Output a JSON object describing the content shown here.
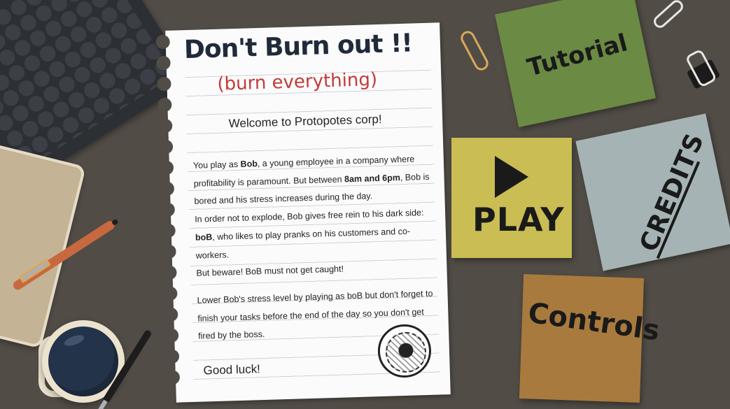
{
  "game": {
    "title": "Don't Burn out !!",
    "subtitle": "(burn everything)",
    "welcome": "Welcome to Protopotes corp!",
    "intro": {
      "line1_a": "You play as ",
      "bob": "Bob",
      "line1_b": ", a young employee in a company where profitability is paramount. But between ",
      "hours": "8am and 6pm",
      "line1_c": ", Bob is bored and his stress increases during the day.",
      "line2_a": "In order not to explode, Bob gives free rein to his dark side: ",
      "bob_dark": "boB",
      "line2_b": ", who likes to play pranks on his customers and co-workers.",
      "line3": "But beware! BoB must not get caught!"
    },
    "goal": "Lower Bob's stress level by playing as boB but don't forget to finish your tasks before the end of the day so you don't get fired by the boss.",
    "goodluck": "Good luck!",
    "logo_text": "Protopotes"
  },
  "menu": {
    "tutorial": "Tutorial",
    "play": "PLAY",
    "credits": "CREDITS",
    "controls": "Controls"
  }
}
